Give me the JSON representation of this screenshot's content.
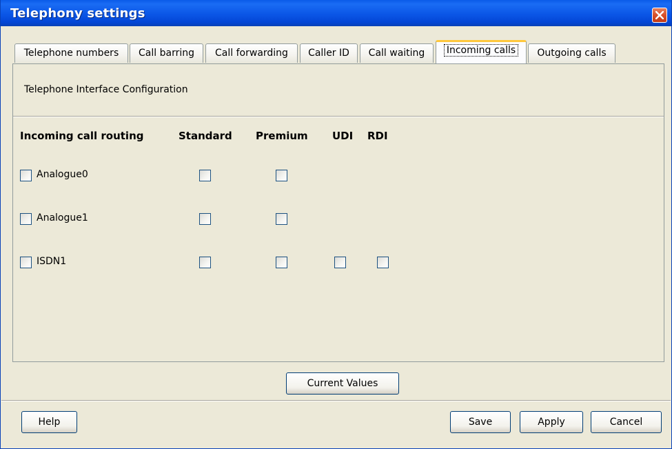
{
  "window": {
    "title": "Telephony settings",
    "close_icon": "close-icon"
  },
  "tabs": [
    {
      "label": "Telephone numbers",
      "active": false
    },
    {
      "label": "Call barring",
      "active": false
    },
    {
      "label": "Call forwarding",
      "active": false
    },
    {
      "label": "Caller ID",
      "active": false
    },
    {
      "label": "Call waiting",
      "active": false
    },
    {
      "label": "Incoming calls",
      "active": true
    },
    {
      "label": "Outgoing calls",
      "active": false
    }
  ],
  "panel": {
    "section_label": "Telephone Interface Configuration",
    "columns": {
      "routing": "Incoming call routing",
      "standard": "Standard",
      "premium": "Premium",
      "udi": "UDI",
      "rdi": "RDI"
    },
    "rows": [
      {
        "label": "Analogue0",
        "enabled": false,
        "standard": false,
        "premium": false
      },
      {
        "label": "Analogue1",
        "enabled": false,
        "standard": false,
        "premium": false
      },
      {
        "label": "ISDN1",
        "enabled": false,
        "standard": false,
        "premium": false,
        "udi": false,
        "rdi": false
      }
    ]
  },
  "buttons": {
    "current_values": "Current Values",
    "help": "Help",
    "save": "Save",
    "apply": "Apply",
    "cancel": "Cancel"
  },
  "colors": {
    "titlebar": "#0b56e6",
    "active_tab_accent": "#ffc83c",
    "close_button": "#d8502a",
    "background": "#ece9d8"
  }
}
